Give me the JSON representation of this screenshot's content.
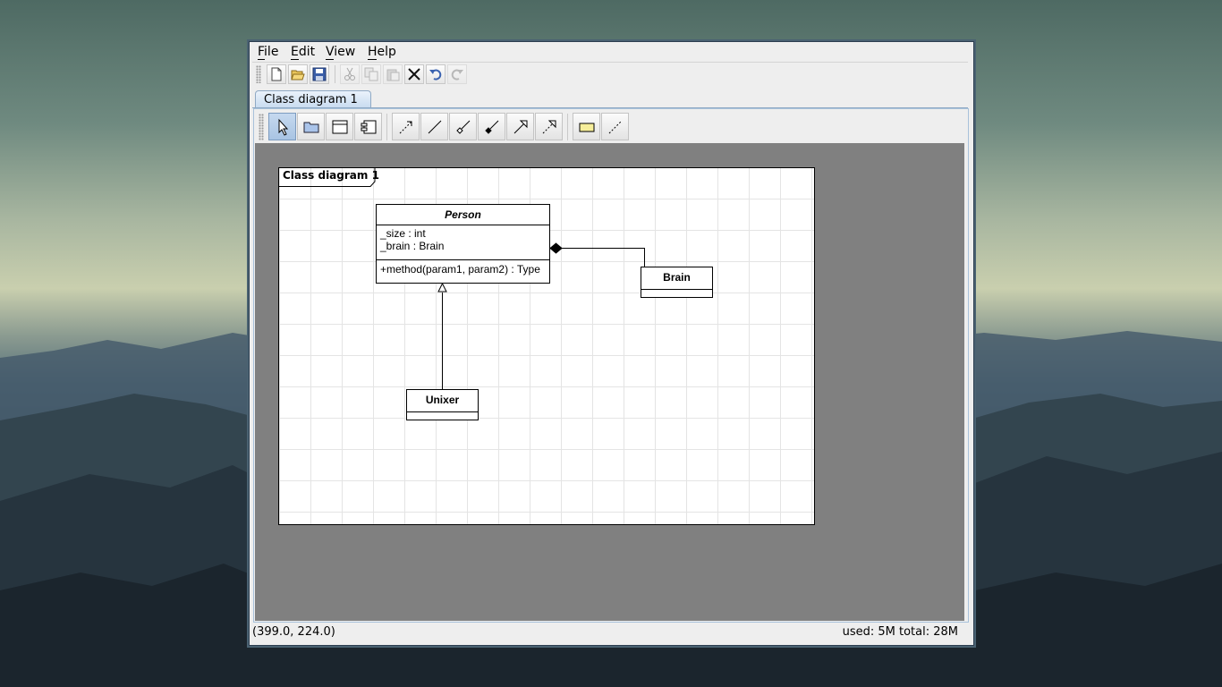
{
  "menubar": {
    "file": "File",
    "edit": "Edit",
    "view": "View",
    "help": "Help"
  },
  "main_toolbar": [
    "new-file",
    "open-folder",
    "save",
    "cut",
    "copy",
    "paste",
    "delete",
    "undo",
    "redo"
  ],
  "palette": [
    "select",
    "package",
    "class",
    "component",
    "dependency",
    "association",
    "aggregation",
    "composition",
    "generalization",
    "realization",
    "note",
    "note-link"
  ],
  "tab": {
    "label": "Class diagram 1"
  },
  "diagram": {
    "frame_title": "Class diagram 1",
    "classes": {
      "person": {
        "name": "Person",
        "attributes": [
          "_size : int",
          "_brain : Brain"
        ],
        "operations": [
          "+method(param1, param2) : Type"
        ]
      },
      "brain": {
        "name": "Brain"
      },
      "unixer": {
        "name": "Unixer"
      }
    },
    "relationships": [
      {
        "type": "composition",
        "from": "Person",
        "to": "Brain"
      },
      {
        "type": "generalization",
        "from": "Unixer",
        "to": "Person"
      }
    ]
  },
  "status": {
    "coords": "(399.0, 224.0)",
    "memory": "used: 5M total: 28M"
  },
  "colors": {
    "canvas_bg": "#808080",
    "tab_bg": "#c9dcf0",
    "selected_tool": "#a9c4e3",
    "note_fill": "#f6ee9a"
  }
}
